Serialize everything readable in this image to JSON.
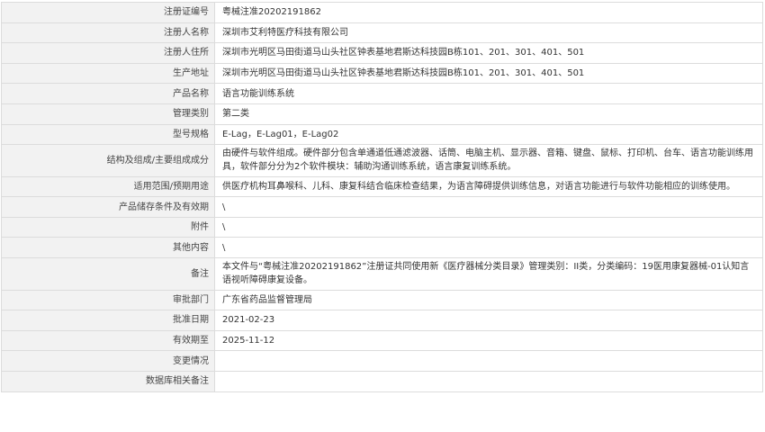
{
  "rows": [
    {
      "label": "注册证编号",
      "value": "粤械注准20202191862"
    },
    {
      "label": "注册人名称",
      "value": "深圳市艾利特医疗科技有限公司"
    },
    {
      "label": "注册人住所",
      "value": "深圳市光明区马田街道马山头社区钟表基地君斯达科技园B栋101、201、301、401、501"
    },
    {
      "label": "生产地址",
      "value": "深圳市光明区马田街道马山头社区钟表基地君斯达科技园B栋101、201、301、401、501"
    },
    {
      "label": "产品名称",
      "value": "语言功能训练系统"
    },
    {
      "label": "管理类别",
      "value": "第二类"
    },
    {
      "label": "型号规格",
      "value": "E-Lag，E-Lag01，E-Lag02"
    },
    {
      "label": "结构及组成/主要组成成分",
      "value": "由硬件与软件组成。硬件部分包含单通道低通滤波器、话筒、电脑主机、显示器、音箱、键盘、鼠标、打印机、台车、语言功能训练用具，软件部分分为2个软件模块：辅助沟通训练系统，语言康复训练系统。"
    },
    {
      "label": "适用范围/预期用途",
      "value": "供医疗机构耳鼻喉科、儿科、康复科结合临床检查结果，为语言障碍提供训练信息，对语言功能进行与软件功能相应的训练使用。"
    },
    {
      "label": "产品储存条件及有效期",
      "value": "\\"
    },
    {
      "label": "附件",
      "value": "\\"
    },
    {
      "label": "其他内容",
      "value": "\\"
    },
    {
      "label": "备注",
      "value": "本文件与“粤械注准20202191862”注册证共同使用新《医疗器械分类目录》管理类别：II类，分类编码：19医用康复器械-01认知言语视听障碍康复设备。"
    },
    {
      "label": "审批部门",
      "value": "广东省药品监督管理局"
    },
    {
      "label": "批准日期",
      "value": "2021-02-23"
    },
    {
      "label": "有效期至",
      "value": "2025-11-12"
    },
    {
      "label": "变更情况",
      "value": ""
    },
    {
      "label": "数据库相关备注",
      "value": ""
    }
  ]
}
